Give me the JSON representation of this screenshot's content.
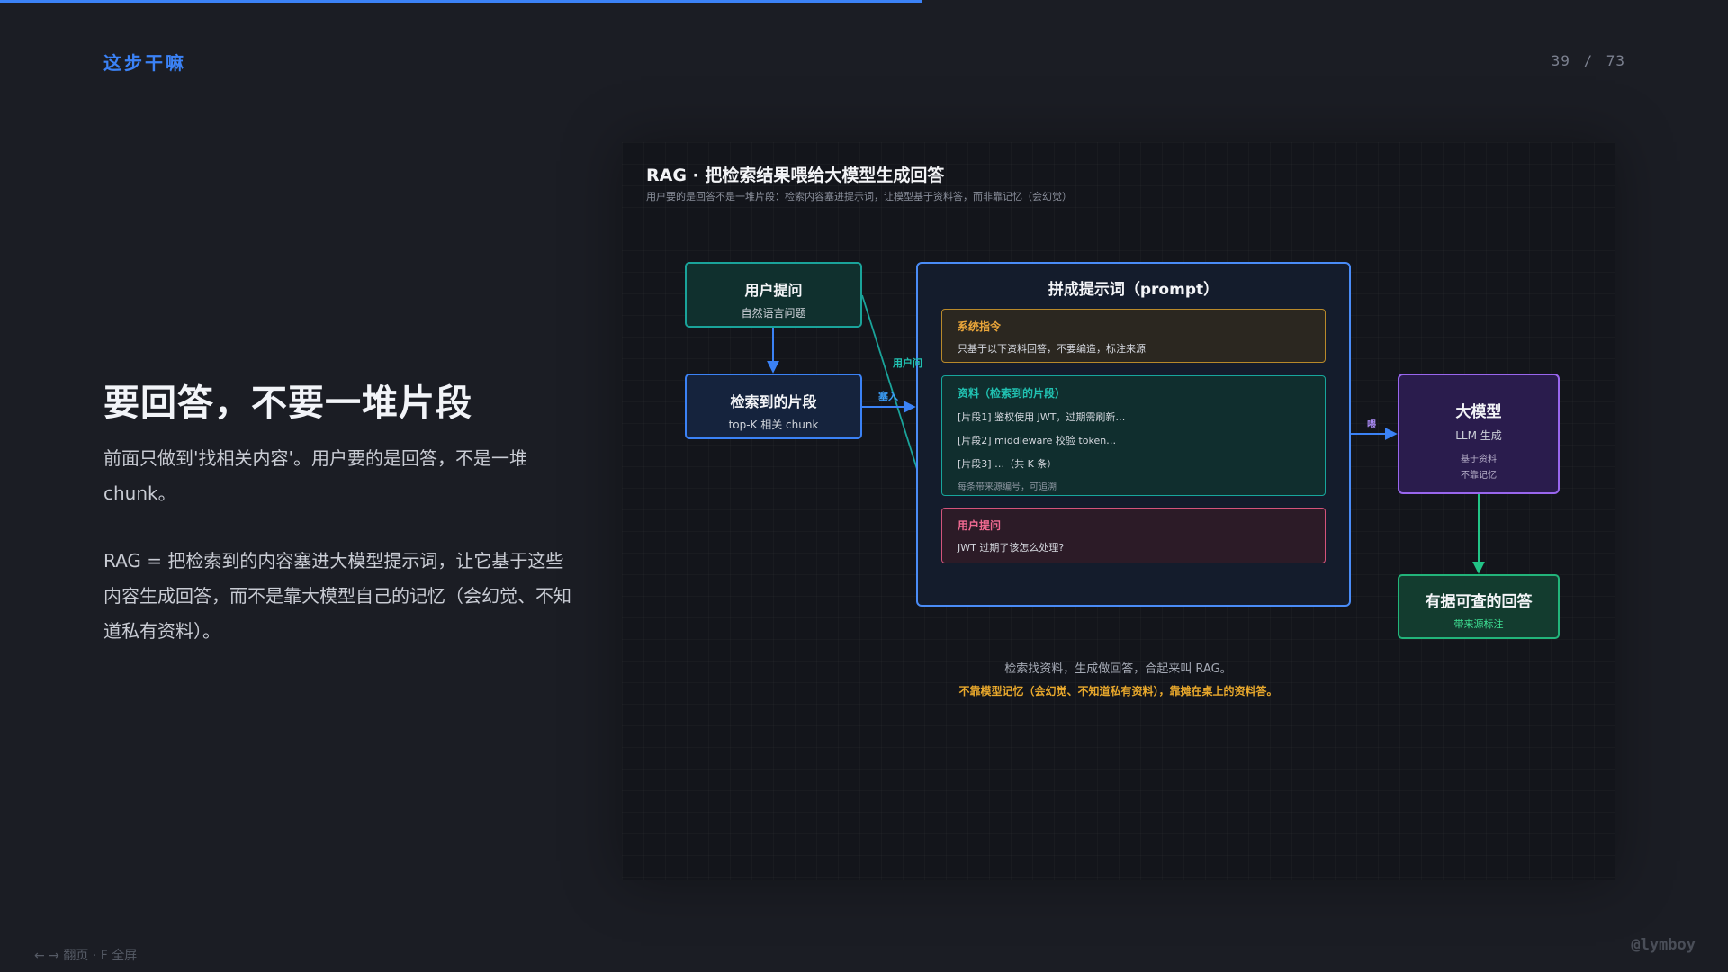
{
  "progress": 0.534,
  "header": {
    "section_label": "这步干嘛",
    "page_counter": "39 / 73"
  },
  "slide": {
    "heading": "要回答，不要一堆片段",
    "paragraph_1": "前面只做到'找相关内容'。用户要的是回答，不是一堆 chunk。",
    "paragraph_2": "RAG = 把检索到的内容塞进大模型提示词，让它基于这些内容生成回答，而不是靠大模型自己的记忆（会幻觉、不知道私有资料）。"
  },
  "diagram": {
    "title": "RAG · 把检索结果喂给大模型生成回答",
    "subtitle": "用户要的是回答不是一堆片段：检索内容塞进提示词，让模型基于资料答，而非靠记忆（会幻觉）",
    "user_question": {
      "title": "用户提问",
      "sub": "自然语言问题"
    },
    "retrieved": {
      "title": "检索到的片段",
      "sub": "top-K 相关 chunk"
    },
    "prompt": {
      "title": "拼成提示词（prompt）",
      "system": {
        "heading": "系统指令",
        "line": "只基于以下资料回答，不要编造，标注来源"
      },
      "material": {
        "heading": "资料（检索到的片段）",
        "line_1": "[片段1] 鉴权使用 JWT，过期需刷新…",
        "line_2": "[片段2] middleware 校验 token…",
        "line_3": "[片段3] …（共 K 条）",
        "note": "每条带来源编号，可追溯"
      },
      "user": {
        "heading": "用户提问",
        "line": "JWT 过期了该怎么处理?"
      }
    },
    "llm": {
      "title": "大模型",
      "sub": "LLM 生成",
      "note_1": "基于资料",
      "note_2": "不靠记忆"
    },
    "answer": {
      "title": "有据可查的回答",
      "sub": "带来源标注"
    },
    "edge_labels": {
      "user_ask": "用户问",
      "insert": "塞入",
      "feed": "喂"
    },
    "caption_1": "检索找资料，生成做回答，合起来叫 RAG。",
    "caption_2": "不靠模型记忆（会幻觉、不知道私有资料），靠摊在桌上的资料答。",
    "colors": {
      "teal": "#1aa39a",
      "blue": "#3b82f6",
      "purple": "#9966ee",
      "green": "#22b47a",
      "amber": "#e8a82c",
      "pink": "#d4537a"
    }
  },
  "footer": {
    "nav_hint": "← → 翻页 · F 全屏",
    "watermark": "@lymboy"
  }
}
